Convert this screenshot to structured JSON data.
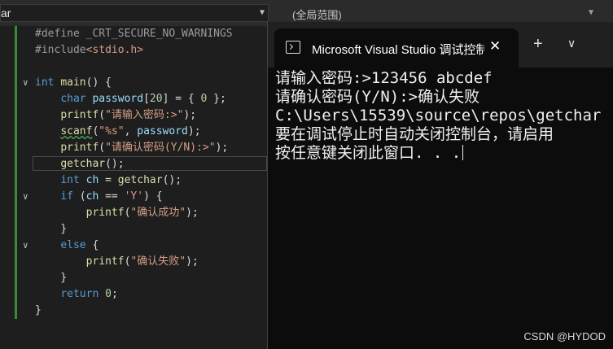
{
  "file_combo": {
    "text": "ar"
  },
  "scope_combo": {
    "text": "(全局范围)"
  },
  "code": [
    {
      "fold": "",
      "html": "<span class='pp'>#define</span> <span class='pp'>_CRT_SECURE_NO_WARNINGS</span>"
    },
    {
      "fold": "",
      "html": "<span class='pp'>#include</span><span class='str'>&lt;stdio.h&gt;</span>"
    },
    {
      "fold": "",
      "html": ""
    },
    {
      "fold": "∨",
      "html": "<span class='kw'>int</span> <span class='fn'>main</span>() {"
    },
    {
      "fold": "",
      "html": "    <span class='kw'>char</span> <span class='var'>password</span>[<span class='num'>20</span>] = { <span class='num'>0</span> };"
    },
    {
      "fold": "",
      "html": "    <span class='fn'>printf</span>(<span class='str'>\"请输入密码:&gt;\"</span>);"
    },
    {
      "fold": "",
      "html": "    <span class='fn squig'>scanf</span>(<span class='str'>\"%s\"</span>, <span class='var'>password</span>);"
    },
    {
      "fold": "",
      "html": "    <span class='fn'>printf</span>(<span class='str'>\"请确认密码(Y/N):&gt;\"</span>);"
    },
    {
      "fold": "",
      "html": "    <span class='fn'>getchar</span>();"
    },
    {
      "fold": "",
      "html": "    <span class='kw'>int</span> <span class='var'>ch</span> = <span class='fn'>getchar</span>();"
    },
    {
      "fold": "∨",
      "html": "    <span class='kw'>if</span> (<span class='var'>ch</span> == <span class='str'>'Y'</span>) {"
    },
    {
      "fold": "",
      "html": "        <span class='fn'>printf</span>(<span class='str'>\"确认成功\"</span>);"
    },
    {
      "fold": "",
      "html": "    }"
    },
    {
      "fold": "∨",
      "html": "    <span class='kw'>else</span> {"
    },
    {
      "fold": "",
      "html": "        <span class='fn'>printf</span>(<span class='str'>\"确认失败\"</span>);"
    },
    {
      "fold": "",
      "html": "    }"
    },
    {
      "fold": "",
      "html": "    <span class='kw'>return</span> <span class='num'>0</span>;"
    },
    {
      "fold": "",
      "html": "}"
    }
  ],
  "console": {
    "tab_title": "Microsoft Visual Studio 调试控制台",
    "close_glyph": "✕",
    "new_tab_glyph": "+",
    "dropdown_glyph": "∨",
    "lines": [
      "请输入密码:>123456 abcdef",
      "请确认密码(Y/N):>确认失败",
      "C:\\Users\\15539\\source\\repos\\getchar",
      "要在调试停止时自动关闭控制台，请启用",
      "按任意键关闭此窗口. . ."
    ]
  },
  "watermark": "CSDN @HYDOD"
}
